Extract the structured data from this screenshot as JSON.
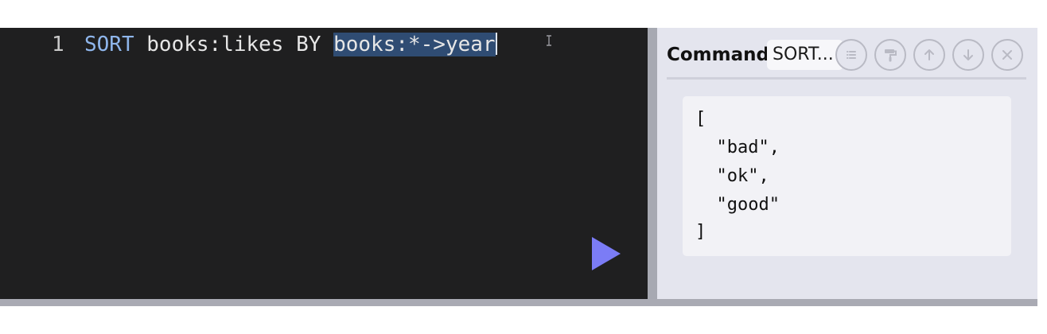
{
  "editor": {
    "line_number": "1",
    "code_keyword": "SORT",
    "code_rest": " books:likes BY ",
    "code_selected": "books:*->year",
    "run_icon": "play-icon"
  },
  "panel": {
    "label": "Command",
    "command_value": "SORT...",
    "buttons": [
      {
        "name": "list-icon"
      },
      {
        "name": "paint-roller-icon"
      },
      {
        "name": "arrow-up-icon"
      },
      {
        "name": "arrow-down-icon"
      },
      {
        "name": "close-icon"
      }
    ],
    "result": {
      "line0": "[",
      "line1": "  \"bad\",",
      "line2": "  \"ok\",",
      "line3": "  \"good\"",
      "line4": "]"
    }
  },
  "colors": {
    "editor_bg": "#1f1f20",
    "keyword": "#8fb6ec",
    "selection": "#2f4c73",
    "run_button": "#7b7cf6",
    "panel_bg": "#e4e5ee"
  }
}
